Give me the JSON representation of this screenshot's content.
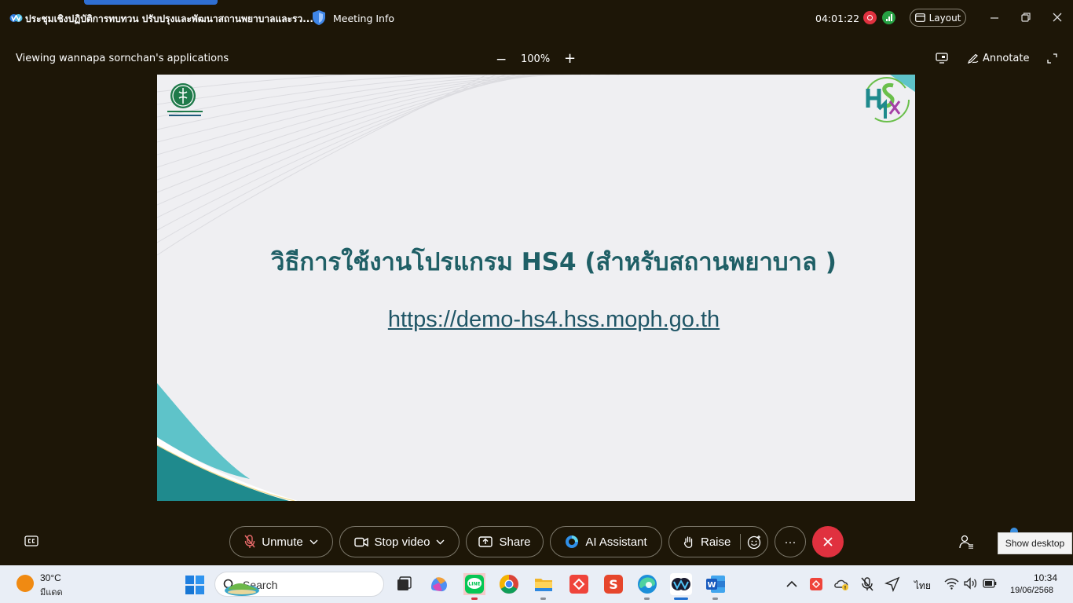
{
  "titlebar": {
    "meeting_title": "ประชุมเชิงปฏิบัติการทบทวน ปรับปรุงและพัฒนาสถานพยาบาลและรว...",
    "meeting_info": "Meeting Info",
    "timer": "04:01:22",
    "layout_label": "Layout"
  },
  "share_bar": {
    "viewing_text": "Viewing wannapa sornchan's applications",
    "zoom_minus": "−",
    "zoom_level": "100%",
    "zoom_plus": "+",
    "annotate_label": "Annotate"
  },
  "slide": {
    "title": "วิธีการใช้งานโปรแกรม HS4 (สำหรับสถานพยาบาล )",
    "link": "https://demo-hs4.hss.moph.go.th"
  },
  "controls": {
    "unmute_label": "Unmute",
    "stop_video_label": "Stop video",
    "share_label": "Share",
    "ai_assistant_label": "AI Assistant",
    "raise_label": "Raise",
    "more_label": "···",
    "show_desktop_tooltip": "Show desktop"
  },
  "taskbar": {
    "weather_temp": "30°C",
    "weather_desc": "มีแดด",
    "search_label": "Search",
    "language": "ไทย",
    "time": "10:34",
    "date": "19/06/2568"
  },
  "colors": {
    "background": "#1d1607",
    "accent_red": "#e0313f",
    "accent_green": "#26a043",
    "slide_teal": "#1f5f66",
    "taskbar_bg": "#e9eef6"
  }
}
